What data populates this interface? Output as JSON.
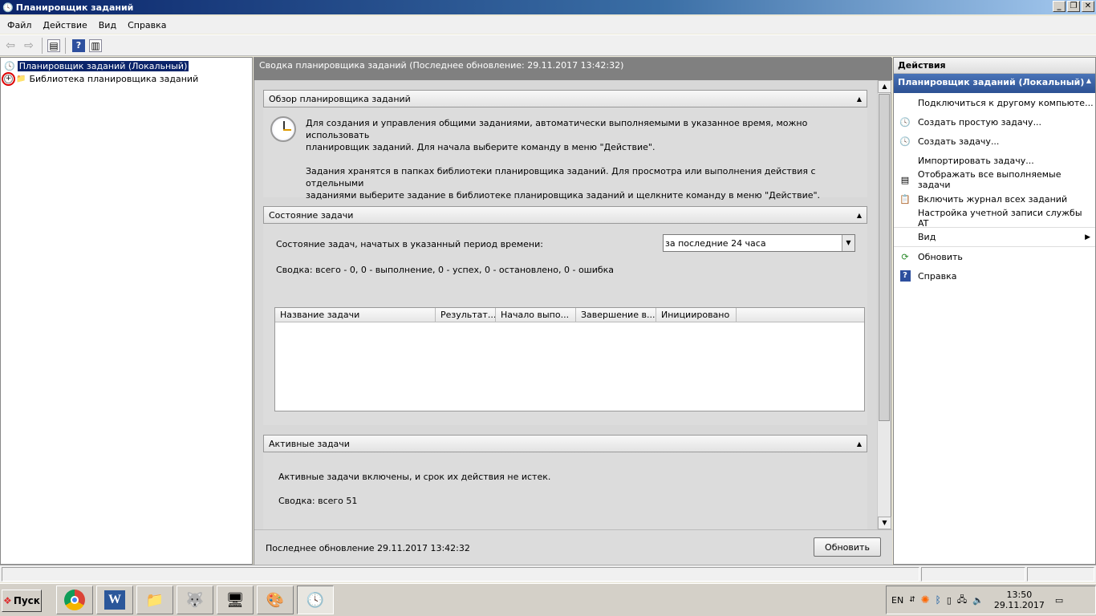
{
  "window": {
    "title": "Планировщик заданий"
  },
  "menu": [
    "Файл",
    "Действие",
    "Вид",
    "Справка"
  ],
  "tree": {
    "root": "Планировщик заданий (Локальный)",
    "child": "Библиотека планировщика заданий"
  },
  "center": {
    "header": "Сводка планировщика заданий (Последнее обновление: 29.11.2017 13:42:32)",
    "overview": {
      "title": "Обзор планировщика заданий",
      "p1_line1": "Для создания и управления общими заданиями, автоматически выполняемыми в указанное время, можно использовать",
      "p1_line2": "планировщик заданий. Для начала выберите команду в меню \"Действие\".",
      "p2_line1": "Задания хранятся в папках библиотеки планировщика заданий. Для просмотра или выполнения действия с отдельными",
      "p2_line2": "заданиями выберите задание в библиотеке планировщика заданий и щелкните команду в меню \"Действие\"."
    },
    "status": {
      "title": "Состояние задачи",
      "period_label": "Состояние задач, начатых в указанный период времени:",
      "period_value": "за последние 24 часа",
      "summary": "Сводка: всего - 0, 0 - выполнение, 0 - успех, 0 - остановлено, 0 - ошибка",
      "columns": [
        "Название задачи",
        "Результат...",
        "Начало выпо...",
        "Завершение в...",
        "Инициировано"
      ]
    },
    "active": {
      "title": "Активные задачи",
      "text": "Активные задачи включены, и срок их действия не истек.",
      "summary": "Сводка: всего 51"
    },
    "footer": {
      "last_update": "Последнее обновление 29.11.2017 13:42:32",
      "refresh_button": "Обновить"
    }
  },
  "actions": {
    "title": "Действия",
    "group": "Планировщик заданий (Локальный)",
    "items": [
      {
        "label": "Подключиться к другому компьюте...",
        "icon": ""
      },
      {
        "label": "Создать простую задачу...",
        "icon": "clock-icon"
      },
      {
        "label": "Создать задачу...",
        "icon": "clock-icon"
      },
      {
        "label": "Импортировать задачу...",
        "icon": ""
      },
      {
        "label": "Отображать все выполняемые задачи",
        "icon": "list-icon"
      },
      {
        "label": "Включить журнал всех заданий",
        "icon": "log-icon"
      },
      {
        "label": "Настройка учетной записи службы AT",
        "icon": ""
      },
      {
        "label": "Вид",
        "icon": ""
      },
      {
        "label": "Обновить",
        "icon": "refresh-icon"
      },
      {
        "label": "Справка",
        "icon": "help-icon"
      }
    ]
  },
  "taskbar": {
    "start": "Пуск",
    "lang": "EN",
    "time": "13:50",
    "date": "29.11.2017"
  }
}
